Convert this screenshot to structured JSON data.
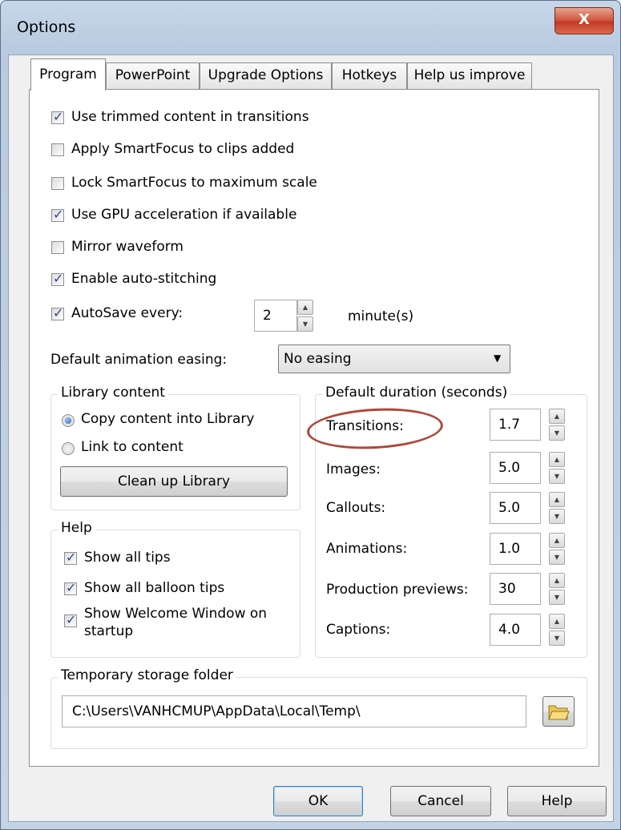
{
  "window": {
    "title": "Options",
    "close_label": "X"
  },
  "tabs": [
    "Program",
    "PowerPoint",
    "Upgrade Options",
    "Hotkeys",
    "Help us improve"
  ],
  "program": {
    "checkboxes": [
      {
        "label": "Use trimmed content in transitions",
        "checked": true
      },
      {
        "label": "Apply SmartFocus to clips added",
        "checked": false
      },
      {
        "label": "Lock SmartFocus to maximum scale",
        "checked": false
      },
      {
        "label": "Use GPU acceleration if available",
        "checked": true
      },
      {
        "label": "Mirror waveform",
        "checked": false
      },
      {
        "label": "Enable auto-stitching",
        "checked": true
      }
    ],
    "autosave": {
      "label": "AutoSave every:",
      "checked": true,
      "value": "2",
      "unit": "minute(s)"
    },
    "easing": {
      "label": "Default animation easing:",
      "value": "No easing"
    },
    "library": {
      "title": "Library content",
      "options": [
        {
          "label": "Copy content into Library",
          "selected": true
        },
        {
          "label": "Link to content",
          "selected": false
        }
      ],
      "cleanup_label": "Clean up Library"
    },
    "help": {
      "title": "Help",
      "items": [
        {
          "label": "Show all tips",
          "checked": true
        },
        {
          "label": "Show all balloon tips",
          "checked": true
        },
        {
          "label_line1": "Show Welcome Window on",
          "label_line2": "startup",
          "checked": true
        }
      ]
    },
    "durations": {
      "title": "Default duration (seconds)",
      "items": [
        {
          "label": "Transitions:",
          "value": "1.7"
        },
        {
          "label": "Images:",
          "value": "5.0"
        },
        {
          "label": "Callouts:",
          "value": "5.0"
        },
        {
          "label": "Animations:",
          "value": "1.0"
        },
        {
          "label": "Production previews:",
          "value": "30"
        },
        {
          "label": "Captions:",
          "value": "4.0"
        }
      ]
    },
    "storage": {
      "title": "Temporary storage folder",
      "path": "C:\\Users\\VANHCMUP\\AppData\\Local\\Temp\\"
    }
  },
  "footer": {
    "ok_label": "OK",
    "cancel_label": "Cancel",
    "help_label": "Help"
  },
  "colors": {
    "annotation_oval": "#b0483a",
    "close_button": "#c9452d"
  }
}
